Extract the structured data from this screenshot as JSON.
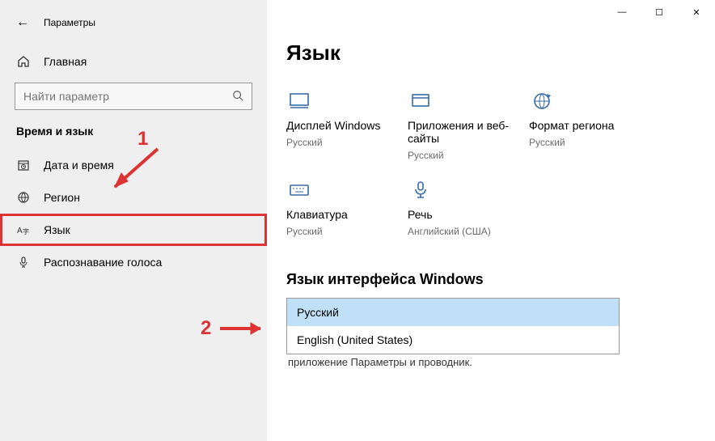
{
  "app": {
    "title": "Параметры"
  },
  "window_controls": {
    "minimize": "—",
    "maximize": "☐",
    "close": "✕"
  },
  "sidebar": {
    "home": "Главная",
    "search_placeholder": "Найти параметр",
    "section": "Время и язык",
    "items": [
      {
        "icon": "calendar-icon",
        "label": "Дата и время"
      },
      {
        "icon": "globe-icon",
        "label": "Регион"
      },
      {
        "icon": "language-icon",
        "label": "Язык"
      },
      {
        "icon": "microphone-icon",
        "label": "Распознавание голоса"
      }
    ],
    "selected_index": 2
  },
  "page": {
    "heading": "Язык",
    "tiles": [
      {
        "icon": "monitor-icon",
        "label": "Дисплей Windows",
        "sub": "Русский"
      },
      {
        "icon": "window-icon",
        "label": "Приложения и веб-сайты",
        "sub": "Русский"
      },
      {
        "icon": "region-format-icon",
        "label": "Формат региона",
        "sub": "Русский"
      },
      {
        "icon": "keyboard-icon",
        "label": "Клавиатура",
        "sub": "Русский"
      },
      {
        "icon": "mic-on-stand-icon",
        "label": "Речь",
        "sub": "Английский (США)"
      }
    ],
    "section_heading": "Язык интерфейса Windows",
    "dropdown": {
      "options": [
        "Русский",
        "English (United States)"
      ],
      "selected_index": 0
    },
    "truncated_text": "приложение  Параметры  и проводник."
  },
  "annotations": {
    "n1": "1",
    "n2": "2"
  }
}
